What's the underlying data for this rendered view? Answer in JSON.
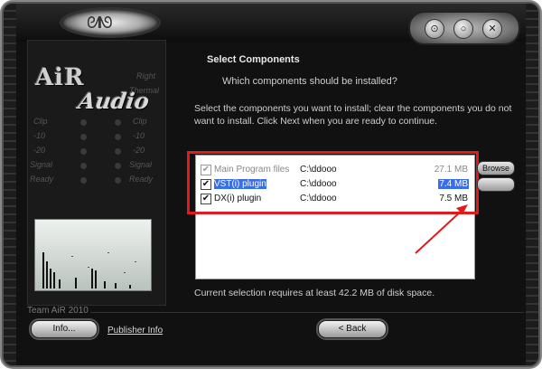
{
  "window": {
    "minimize_glyph": "⊙",
    "restore_glyph": "○",
    "close_glyph": "✕"
  },
  "branding": {
    "logo_line1": "AiR",
    "logo_line2": "Audio",
    "team_label": "Team AiR 2010"
  },
  "meter": {
    "left_labels": [
      "Clip",
      "-10",
      "-20",
      "Signal",
      "Ready"
    ],
    "right_labels": [
      "Right",
      "Thermal",
      "Clip",
      "-10",
      "-20",
      "Signal",
      "Ready"
    ]
  },
  "page": {
    "heading": "Select Components",
    "subheading": "Which components should be installed?",
    "description": "Select the components you want to install; clear the components you do not want to install. Click Next when you are ready to continue.",
    "requirement": "Current selection requires at least 42.2 MB of disk space."
  },
  "components": [
    {
      "name": "Main Program files",
      "path": "C:\\ddooo",
      "size": "27.1 MB",
      "checked": true,
      "disabled": true,
      "selected": false
    },
    {
      "name": "VST(i) plugin",
      "path": "C:\\ddooo",
      "size": "7.4 MB",
      "checked": true,
      "disabled": false,
      "selected": true
    },
    {
      "name": "DX(i) plugin",
      "path": "C:\\ddooo",
      "size": "7.5 MB",
      "checked": true,
      "disabled": false,
      "selected": false
    }
  ],
  "side_buttons": {
    "browse": "Browse",
    "second": ""
  },
  "footer": {
    "info_button": "Info...",
    "publisher_link": "Publisher Info",
    "back_button": "< Back"
  },
  "colors": {
    "highlight": "#e11b1b",
    "selection": "#3a6ee8"
  }
}
